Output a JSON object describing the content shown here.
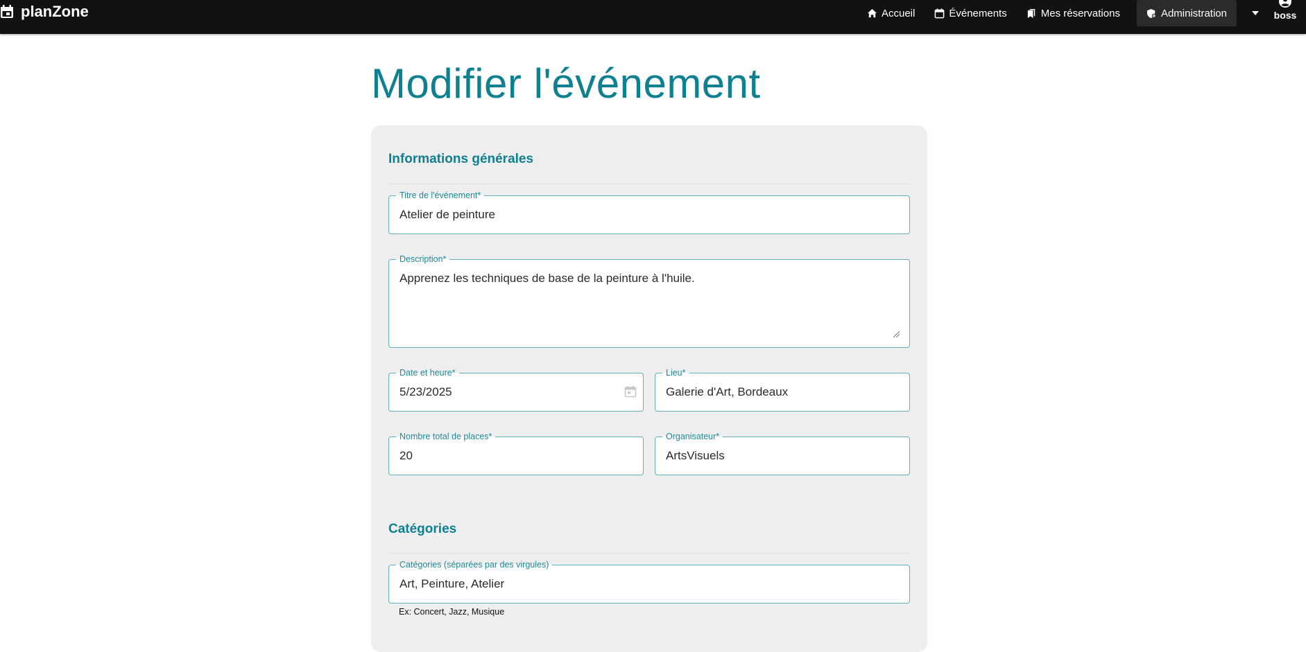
{
  "app": {
    "brand": "planZone"
  },
  "nav": {
    "items": [
      {
        "label": "Accueil",
        "icon": "home-icon"
      },
      {
        "label": "Événements",
        "icon": "calendar-icon"
      },
      {
        "label": "Mes réservations",
        "icon": "bookmarks-icon"
      },
      {
        "label": "Administration",
        "icon": "admin-shield-icon"
      }
    ],
    "user": "boss"
  },
  "page": {
    "title": "Modifier l'événement"
  },
  "form": {
    "general_title": "Informations générales",
    "title": {
      "label": "Titre de l'événement*",
      "value": "Atelier de peinture"
    },
    "description": {
      "label": "Description*",
      "value": "Apprenez les techniques de base de la peinture à l'huile."
    },
    "date": {
      "label": "Date et heure*",
      "value": "5/23/2025"
    },
    "location": {
      "label": "Lieu*",
      "value": "Galerie d'Art, Bordeaux"
    },
    "seats": {
      "label": "Nombre total de places*",
      "value": "20"
    },
    "organizer": {
      "label": "Organisateur*",
      "value": "ArtsVisuels"
    },
    "categories_title": "Catégories",
    "categories": {
      "label": "Catégories (séparées par des virgules)",
      "value": "Art, Peinture, Atelier"
    },
    "categories_hint": "Ex: Concert, Jazz, Musique"
  },
  "colors": {
    "accent": "#0f8090",
    "navbar": "#121212",
    "card": "#eeeeee",
    "field_border": "#5fb3bd"
  }
}
